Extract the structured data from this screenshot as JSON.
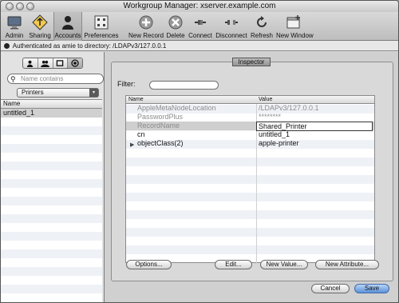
{
  "window": {
    "title": "Workgroup Manager: xserver.example.com"
  },
  "toolbar": {
    "items": [
      {
        "label": "Admin",
        "icon": "admin-icon"
      },
      {
        "label": "Sharing",
        "icon": "sharing-icon"
      },
      {
        "label": "Accounts",
        "icon": "accounts-icon"
      },
      {
        "label": "Preferences",
        "icon": "preferences-icon"
      },
      {
        "label": "New Record",
        "icon": "new-record-icon"
      },
      {
        "label": "Delete",
        "icon": "delete-icon"
      },
      {
        "label": "Connect",
        "icon": "connect-icon"
      },
      {
        "label": "Disconnect",
        "icon": "disconnect-icon"
      },
      {
        "label": "Refresh",
        "icon": "refresh-icon"
      },
      {
        "label": "New Window",
        "icon": "new-window-icon"
      }
    ]
  },
  "status": {
    "text": "Authenticated as amie to directory: /LDAPv3/127.0.0.1"
  },
  "sidebar": {
    "search_placeholder": "Name contains",
    "record_type": "Printers",
    "list_header": "Name",
    "items": [
      "untitled_1"
    ]
  },
  "inspector": {
    "tab_label": "Inspector",
    "filter_label": "Filter:",
    "filter_value": "",
    "columns": [
      "Name",
      "Value"
    ],
    "rows": [
      {
        "name": "AppleMetaNodeLocation",
        "value": "/LDAPv3/127.0.0.1",
        "dim": true
      },
      {
        "name": "PasswordPlus",
        "value": "********",
        "dim": true
      },
      {
        "name": "RecordName",
        "value": "Shared_Printer",
        "dim": true,
        "editing": true
      },
      {
        "name": "cn",
        "value": "untitled_1",
        "dim": false
      },
      {
        "name": "objectClass(2)",
        "value": "apple-printer",
        "dim": false,
        "expandable": true
      }
    ],
    "buttons": {
      "options": "Options...",
      "edit": "Edit...",
      "new_value": "New Value...",
      "new_attribute": "New Attribute..."
    }
  },
  "footer": {
    "cancel": "Cancel",
    "save": "Save"
  },
  "colors": {
    "accent": "#5c91d9"
  }
}
